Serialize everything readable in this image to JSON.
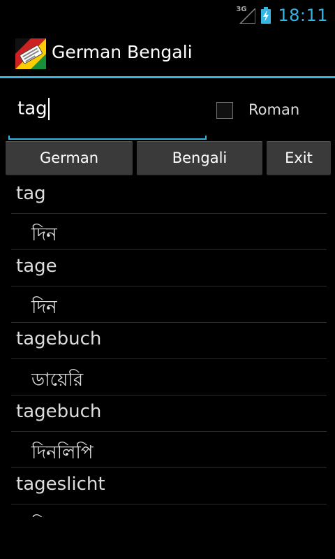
{
  "status_bar": {
    "network_label": "3G",
    "time": "18:11"
  },
  "action_bar": {
    "title": "German Bengali"
  },
  "search": {
    "value": "tag"
  },
  "roman": {
    "label": "Roman",
    "checked": false
  },
  "buttons": {
    "german": "German",
    "bengali": "Bengali",
    "exit": "Exit"
  },
  "results": [
    {
      "word": "tag",
      "translation": "দিন"
    },
    {
      "word": "tage",
      "translation": "দিন"
    },
    {
      "word": "tagebuch",
      "translation": "ডায়েরি"
    },
    {
      "word": "tagebuch",
      "translation": "দিনলিপি"
    },
    {
      "word": "tageslicht",
      "translation": "দিনের আলো"
    }
  ],
  "colors": {
    "accent": "#33b5e5",
    "background": "#000000",
    "button": "#3a3a3a"
  }
}
